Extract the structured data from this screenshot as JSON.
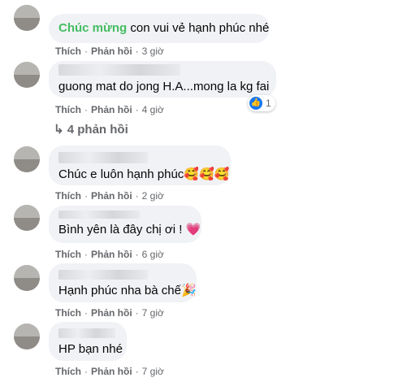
{
  "comments": [
    {
      "text_highlight": "Chúc mừng",
      "text": " con vui vẻ hạnh phúc nhé",
      "like": "Thích",
      "reply": "Phản hồi",
      "time": "3 giờ"
    },
    {
      "text": "guong mat do jong H.A...mong la kg fai",
      "like": "Thích",
      "reply": "Phản hồi",
      "time": "4 giờ",
      "reaction_count": "1",
      "reaction_icon": "like-icon"
    },
    {
      "text": "Chúc e luôn hạnh phúc🥰🥰🥰",
      "like": "Thích",
      "reply": "Phản hồi",
      "time": "2 giờ"
    },
    {
      "text": "Bình yên là đây chị ơi ! 💗",
      "like": "Thích",
      "reply": "Phản hồi",
      "time": "6 giờ"
    },
    {
      "text": "Hạnh phúc nha bà chế🎉",
      "like": "Thích",
      "reply": "Phản hồi",
      "time": "7 giờ"
    },
    {
      "text": "HP bạn nhé",
      "like": "Thích",
      "reply": "Phản hồi",
      "time": "7 giờ"
    }
  ],
  "replies_link": "↳ 4 phản hồi",
  "colors": {
    "bubble": "#f0f2f5",
    "meta": "#65676b",
    "highlight": "#45bd62",
    "like": "#1877f2"
  }
}
